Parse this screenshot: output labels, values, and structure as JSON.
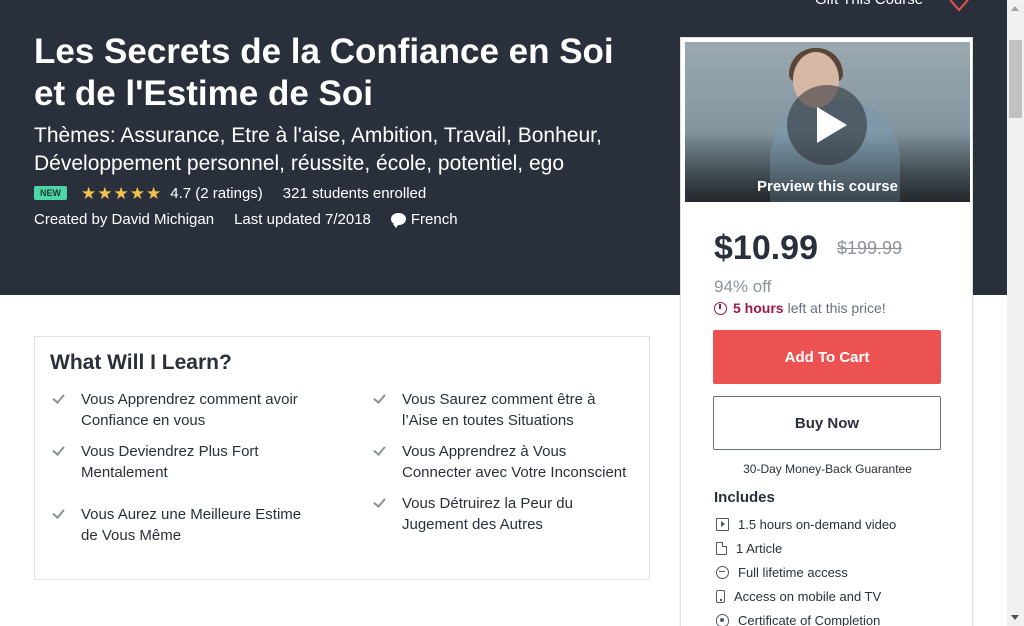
{
  "header": {
    "gift_label": "Gift This Course",
    "title": "Les Secrets de la Confiance en Soi et de l'Estime de Soi",
    "subtitle": "Thèmes: Assurance, Etre à l'aise, Ambition, Travail, Bonheur, Développement personnel, réussite, école, potentiel, ego",
    "badge": "NEW",
    "rating_stars": 4.7,
    "rating_text": "4.7 (2 ratings)",
    "enrolled": "321 students enrolled",
    "created_by": "Created by David Michigan",
    "last_updated": "Last updated 7/2018",
    "language": "French"
  },
  "sidebar": {
    "preview_label": "Preview this course",
    "price": "$10.99",
    "original_price": "$199.99",
    "discount": "94% off",
    "timer_strong": "5 hours",
    "timer_rest": "left at this price!",
    "add_to_cart": "Add To Cart",
    "buy_now": "Buy Now",
    "guarantee": "30-Day Money-Back Guarantee",
    "includes_title": "Includes",
    "includes": [
      {
        "icon": "video-icon",
        "label": "1.5 hours on-demand video"
      },
      {
        "icon": "file-icon",
        "label": "1 Article"
      },
      {
        "icon": "infinity-icon",
        "label": "Full lifetime access"
      },
      {
        "icon": "mobile-icon",
        "label": "Access on mobile and TV"
      },
      {
        "icon": "certificate-icon",
        "label": "Certificate of Completion"
      }
    ]
  },
  "learn": {
    "title": "What Will I Learn?",
    "left": [
      "Vous Apprendrez comment avoir Confiance en vous",
      "Vous Deviendrez Plus Fort Mentalement",
      "Vous Aurez une Meilleure Estime de Vous Même"
    ],
    "right": [
      "Vous Saurez comment être à l’Aise en toutes Situations",
      "Vous Apprendrez à Vous Connecter avec Votre Inconscient",
      "Vous Détruirez la Peur du Jugement des Autres"
    ]
  },
  "colors": {
    "hero_bg": "#29303b",
    "cart_button": "#ec5252",
    "star": "#f4c150",
    "badge_new": "#4ed5a5",
    "timer_accent": "#a1154b"
  }
}
